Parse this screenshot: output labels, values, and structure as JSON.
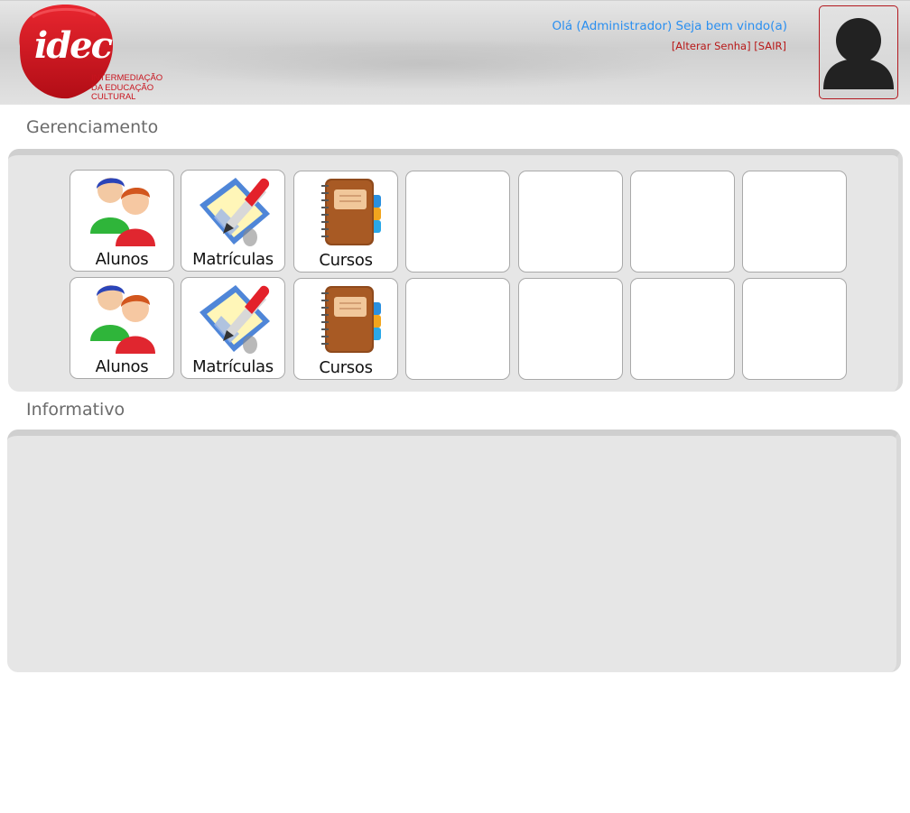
{
  "brand": {
    "logo_text": "idec",
    "tagline": [
      "INTERMEDIAÇÃO",
      "DA EDUCAÇÃO",
      "CULTURAL"
    ],
    "primary_color": "#c8141e"
  },
  "user": {
    "greeting": "Olá (Administrador) Seja bem vindo(a)",
    "change_password": "[Alterar Senha]",
    "logout": "[SAIR]",
    "avatar_icon": "user-silhouette-icon"
  },
  "sections": {
    "management_title": "Gerenciamento",
    "info_title": "Informativo"
  },
  "tiles": {
    "row1": [
      {
        "label": "Alunos",
        "icon": "students-icon"
      },
      {
        "label": "Matrículas",
        "icon": "enrollment-icon"
      },
      {
        "label": "Cursos",
        "icon": "notebook-icon"
      }
    ],
    "row2": [
      {
        "label": "Alunos",
        "icon": "students-icon"
      },
      {
        "label": "Matrículas",
        "icon": "enrollment-icon"
      },
      {
        "label": "Cursos",
        "icon": "notebook-icon"
      }
    ],
    "empty_slots_per_row": 4
  }
}
